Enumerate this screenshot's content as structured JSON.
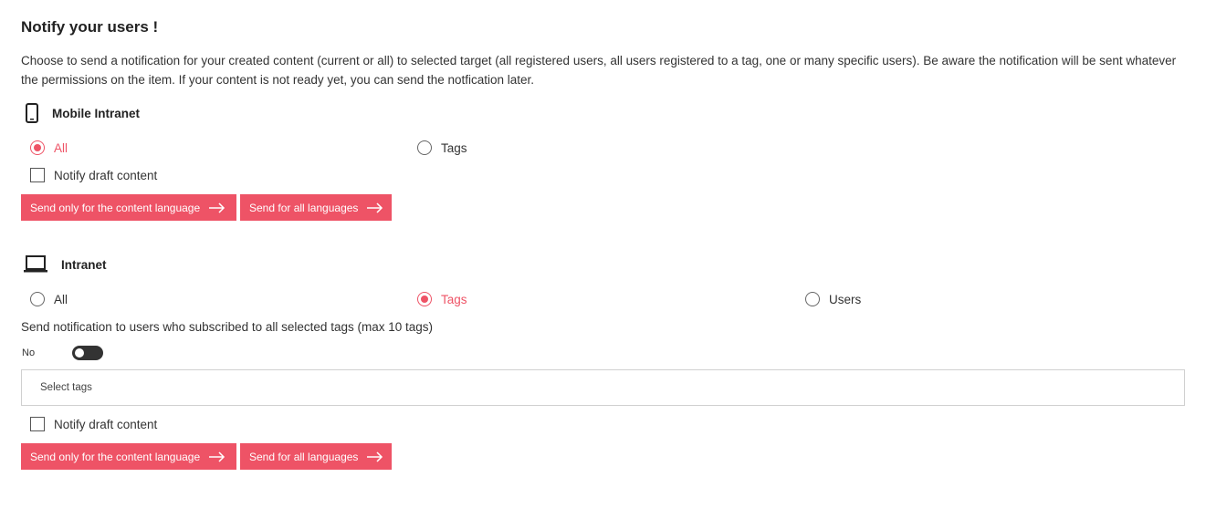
{
  "page": {
    "title": "Notify your users !",
    "description": "Choose to send a notification for your created content (current or all) to selected target (all registered users, all users registered to a tag, one or many specific users). Be aware the notification will be sent whatever the permissions on the item. If your content is not ready yet, you can send the notfication later."
  },
  "accent_color": "#ee5366",
  "mobile": {
    "icon": "mobile-phone-icon",
    "label": "Mobile Intranet",
    "options": {
      "all": "All",
      "tags": "Tags"
    },
    "selected": "All",
    "draft_label": "Notify draft content",
    "draft_checked": false,
    "send_content_language": "Send only for the content language",
    "send_all_languages": "Send for all languages"
  },
  "intranet": {
    "icon": "laptop-icon",
    "label": "Intranet",
    "options": {
      "all": "All",
      "tags": "Tags",
      "users": "Users"
    },
    "selected": "Tags",
    "subscribed_note": "Send notification to users who subscribed to all selected tags (max 10 tags)",
    "toggle_label": "No",
    "toggle_on": false,
    "select_tags_placeholder": "Select tags",
    "draft_label": "Notify draft content",
    "draft_checked": false,
    "send_content_language": "Send only for the content language",
    "send_all_languages": "Send for all languages"
  }
}
